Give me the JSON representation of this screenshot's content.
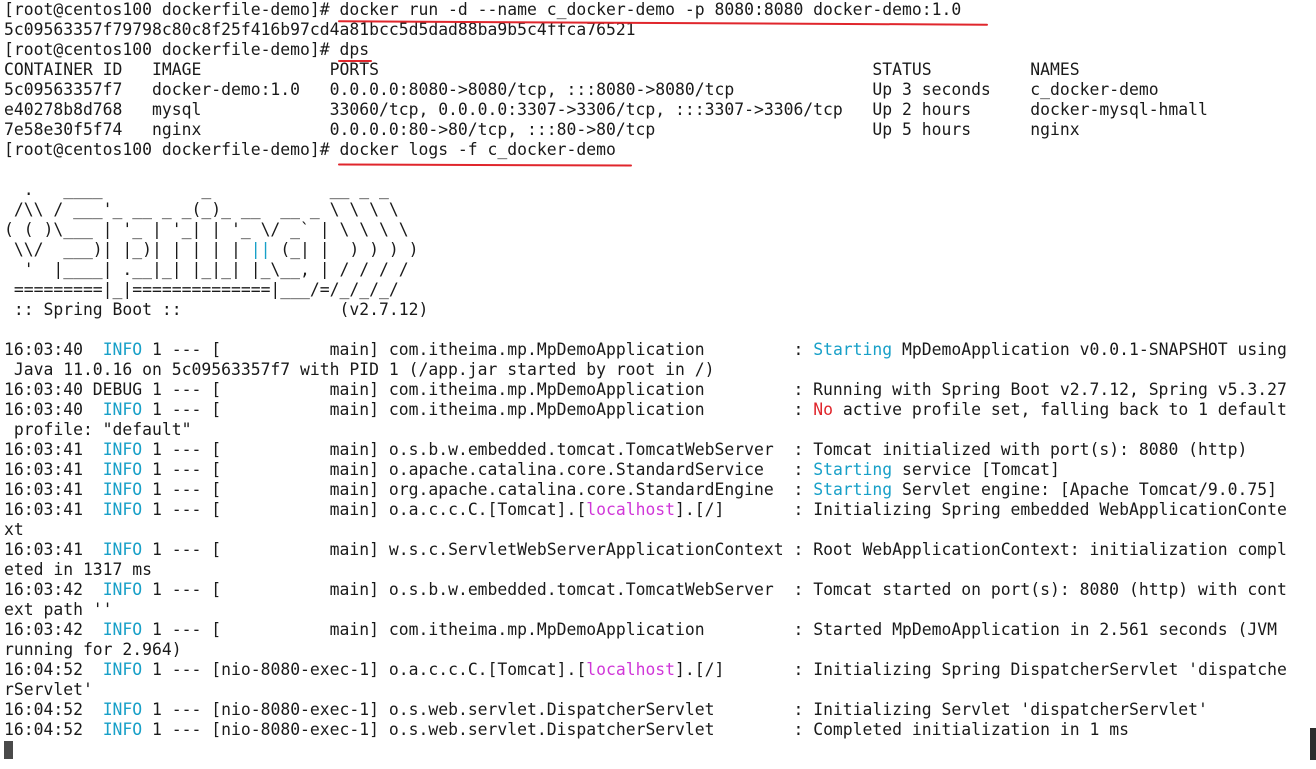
{
  "colors": {
    "background": "#ffffff",
    "text": "#1a1a1a",
    "info": "#18a0c8",
    "localhost": "#d038d8",
    "warn": "#e0262c",
    "underline": "#e0262c",
    "ascii_accent": "#1f4fd0"
  },
  "lines": [
    [
      {
        "t": "[root@centos100 dockerfile-demo]# docker run -d --name c_docker-demo -p 8080:8080 docker-demo:1.0",
        "c": "default"
      }
    ],
    [
      {
        "t": "5c09563357f79798c80c8f25f416b97cd4a81bcc5d5dad88ba9b5c4ffca76521",
        "c": "default"
      }
    ],
    [
      {
        "t": "[root@centos100 dockerfile-demo]# dps",
        "c": "default"
      }
    ],
    [
      {
        "t": "CONTAINER ID   IMAGE             PORTS                                                  STATUS          NAMES",
        "c": "default"
      }
    ],
    [
      {
        "t": "5c09563357f7   docker-demo:1.0   0.0.0.0:8080->8080/tcp, :::8080->8080/tcp              Up 3 seconds    c_docker-demo",
        "c": "default"
      }
    ],
    [
      {
        "t": "e40278b8d768   mysql             33060/tcp, 0.0.0.0:3307->3306/tcp, :::3307->3306/tcp   Up 2 hours      docker-mysql-hmall",
        "c": "default"
      }
    ],
    [
      {
        "t": "7e58e30f5f74   nginx             0.0.0.0:80->80/tcp, :::80->80/tcp                      Up 5 hours      nginx",
        "c": "default"
      }
    ],
    [
      {
        "t": "[root@centos100 dockerfile-demo]# docker logs -f c_docker-demo",
        "c": "default"
      }
    ],
    [
      {
        "t": "",
        "c": "default"
      }
    ],
    [
      {
        "t": "  .   ____          _            __ _ _",
        "c": "default"
      }
    ],
    [
      {
        "t": " /\\\\ / ___'_ __ _ _(_)_ __  __ _ \\ \\ \\ \\",
        "c": "default"
      }
    ],
    [
      {
        "t": "( ( )\\___ | '_ | '_| | '_ \\/ _` | \\ \\ \\ \\",
        "c": "default"
      }
    ],
    [
      {
        "t": " \\\\/  ___)| |_)| | | | | ",
        "c": "default"
      },
      {
        "t": "||",
        "c": "info"
      },
      {
        "t": " (_| |  ) ) ) )",
        "c": "default"
      }
    ],
    [
      {
        "t": "  '  |____| .__|_| |_|_| |_\\__, | / / / /",
        "c": "default"
      }
    ],
    [
      {
        "t": " =========|_|==============|___/=/_/_/_/",
        "c": "default"
      }
    ],
    [
      {
        "t": " :: Spring Boot ::                (v2.7.12)",
        "c": "default"
      }
    ],
    [
      {
        "t": "",
        "c": "default"
      }
    ],
    [
      {
        "t": "16:03:40  ",
        "c": "default"
      },
      {
        "t": "INFO",
        "c": "info"
      },
      {
        "t": " 1 --- [           main] com.itheima.mp.MpDemoApplication         : ",
        "c": "default"
      },
      {
        "t": "Starting",
        "c": "info"
      },
      {
        "t": " MpDemoApplication v0.0.1-SNAPSHOT using",
        "c": "default"
      }
    ],
    [
      {
        "t": " Java 11.0.16 on 5c09563357f7 with PID 1 (/app.jar started by root in /)",
        "c": "default"
      }
    ],
    [
      {
        "t": "16:03:40 DEBUG 1 --- [           main] com.itheima.mp.MpDemoApplication         : Running with Spring Boot v2.7.12, Spring v5.3.27",
        "c": "default"
      }
    ],
    [
      {
        "t": "16:03:40  ",
        "c": "default"
      },
      {
        "t": "INFO",
        "c": "info"
      },
      {
        "t": " 1 --- [           main] com.itheima.mp.MpDemoApplication         : ",
        "c": "default"
      },
      {
        "t": "No",
        "c": "warn"
      },
      {
        "t": " active profile set, falling back to 1 default",
        "c": "default"
      }
    ],
    [
      {
        "t": " profile: \"default\"",
        "c": "default"
      }
    ],
    [
      {
        "t": "16:03:41  ",
        "c": "default"
      },
      {
        "t": "INFO",
        "c": "info"
      },
      {
        "t": " 1 --- [           main] o.s.b.w.embedded.tomcat.TomcatWebServer  : Tomcat initialized with port(s): 8080 (http)",
        "c": "default"
      }
    ],
    [
      {
        "t": "16:03:41  ",
        "c": "default"
      },
      {
        "t": "INFO",
        "c": "info"
      },
      {
        "t": " 1 --- [           main] o.apache.catalina.core.StandardService   : ",
        "c": "default"
      },
      {
        "t": "Starting",
        "c": "info"
      },
      {
        "t": " service [Tomcat]",
        "c": "default"
      }
    ],
    [
      {
        "t": "16:03:41  ",
        "c": "default"
      },
      {
        "t": "INFO",
        "c": "info"
      },
      {
        "t": " 1 --- [           main] org.apache.catalina.core.StandardEngine  : ",
        "c": "default"
      },
      {
        "t": "Starting",
        "c": "info"
      },
      {
        "t": " Servlet engine: [Apache Tomcat/9.0.75]",
        "c": "default"
      }
    ],
    [
      {
        "t": "16:03:41  ",
        "c": "default"
      },
      {
        "t": "INFO",
        "c": "info"
      },
      {
        "t": " 1 --- [           main] o.a.c.c.C.[Tomcat].[",
        "c": "default"
      },
      {
        "t": "localhost",
        "c": "localhost"
      },
      {
        "t": "].[/]       : Initializing Spring embedded WebApplicationConte",
        "c": "default"
      }
    ],
    [
      {
        "t": "xt",
        "c": "default"
      }
    ],
    [
      {
        "t": "16:03:41  ",
        "c": "default"
      },
      {
        "t": "INFO",
        "c": "info"
      },
      {
        "t": " 1 --- [           main] w.s.c.ServletWebServerApplicationContext : Root WebApplicationContext: initialization compl",
        "c": "default"
      }
    ],
    [
      {
        "t": "eted in 1317 ms",
        "c": "default"
      }
    ],
    [
      {
        "t": "16:03:42  ",
        "c": "default"
      },
      {
        "t": "INFO",
        "c": "info"
      },
      {
        "t": " 1 --- [           main] o.s.b.w.embedded.tomcat.TomcatWebServer  : Tomcat started on port(s): 8080 (http) with cont",
        "c": "default"
      }
    ],
    [
      {
        "t": "ext path ''",
        "c": "default"
      }
    ],
    [
      {
        "t": "16:03:42  ",
        "c": "default"
      },
      {
        "t": "INFO",
        "c": "info"
      },
      {
        "t": " 1 --- [           main] com.itheima.mp.MpDemoApplication         : Started MpDemoApplication in 2.561 seconds (JVM",
        "c": "default"
      }
    ],
    [
      {
        "t": "running for 2.964)",
        "c": "default"
      }
    ],
    [
      {
        "t": "16:04:52  ",
        "c": "default"
      },
      {
        "t": "INFO",
        "c": "info"
      },
      {
        "t": " 1 --- [nio-8080-exec-1] o.a.c.c.C.[Tomcat].[",
        "c": "default"
      },
      {
        "t": "localhost",
        "c": "localhost"
      },
      {
        "t": "].[/]       : Initializing Spring DispatcherServlet 'dispatche",
        "c": "default"
      }
    ],
    [
      {
        "t": "rServlet'",
        "c": "default"
      }
    ],
    [
      {
        "t": "16:04:52  ",
        "c": "default"
      },
      {
        "t": "INFO",
        "c": "info"
      },
      {
        "t": " 1 --- [nio-8080-exec-1] o.s.web.servlet.DispatcherServlet        : Initializing Servlet 'dispatcherServlet'",
        "c": "default"
      }
    ],
    [
      {
        "t": "16:04:52  ",
        "c": "default"
      },
      {
        "t": "INFO",
        "c": "info"
      },
      {
        "t": " 1 --- [nio-8080-exec-1] o.s.web.servlet.DispatcherServlet        : Completed initialization in 1 ms",
        "c": "default"
      }
    ]
  ]
}
